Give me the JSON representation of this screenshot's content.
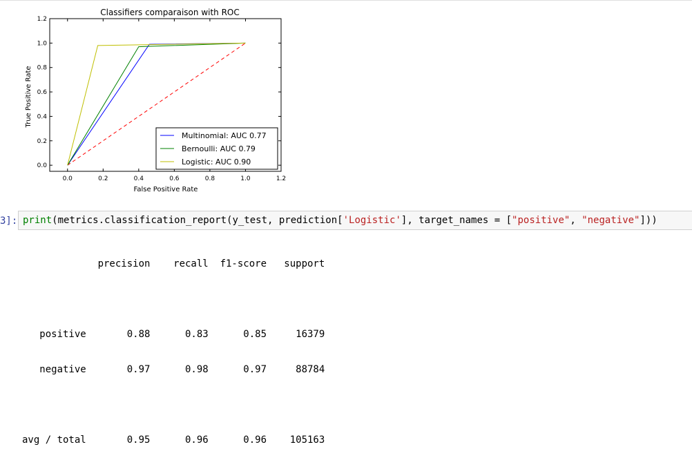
{
  "notebook": {
    "prompt_label": "3]:",
    "code": {
      "func": "print",
      "part1": "(metrics.classification_report(y_test, prediction[",
      "str1": "'Logistic'",
      "part2": "], target_names = [",
      "str2": "\"positive\"",
      "part3": ", ",
      "str3": "\"negative\"",
      "part4": "]))"
    },
    "report_lines": [
      "             precision    recall  f1-score   support",
      "",
      "   positive       0.88      0.83      0.85     16379",
      "   negative       0.97      0.98      0.97     88784",
      "",
      "avg / total       0.95      0.96      0.96    105163"
    ]
  },
  "colors": {
    "multinomial": "#0000ff",
    "bernoulli": "#008000",
    "logistic": "#bfbf00",
    "diagonal": "#ff0000"
  },
  "chart_data": {
    "type": "line",
    "title": "Classifiers comparaison with ROC",
    "xlabel": "False Positive Rate",
    "ylabel": "True Positive Rate",
    "xlim": [
      -0.1,
      1.2
    ],
    "ylim": [
      -0.05,
      1.2
    ],
    "xticks": [
      "0.0",
      "0.2",
      "0.4",
      "0.6",
      "0.8",
      "1.0",
      "1.2"
    ],
    "yticks": [
      "0.0",
      "0.2",
      "0.4",
      "0.6",
      "0.8",
      "1.0",
      "1.2"
    ],
    "grid": false,
    "legend_position": "lower-right",
    "series": [
      {
        "name": "Multinomial: AUC 0.77",
        "color": "#0000ff",
        "x": [
          0.0,
          0.46,
          1.0
        ],
        "y": [
          0.0,
          0.99,
          1.0
        ]
      },
      {
        "name": "Bernoulli: AUC 0.79",
        "color": "#008000",
        "x": [
          0.0,
          0.4,
          1.0
        ],
        "y": [
          0.0,
          0.97,
          1.0
        ]
      },
      {
        "name": "Logistic: AUC 0.90",
        "color": "#bfbf00",
        "x": [
          0.0,
          0.17,
          1.0
        ],
        "y": [
          0.0,
          0.98,
          1.0
        ]
      }
    ],
    "reference_line": {
      "x": [
        0.0,
        1.0
      ],
      "y": [
        0.0,
        1.0
      ],
      "color": "#ff0000",
      "style": "dashed"
    }
  }
}
